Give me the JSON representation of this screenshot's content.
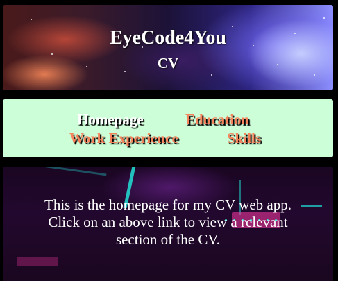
{
  "header": {
    "title": "EyeCode4You",
    "subtitle": "CV"
  },
  "nav": {
    "links": [
      {
        "label": "Homepage",
        "color": "#ffffff",
        "active": true
      },
      {
        "label": "Education",
        "color": "#f5845c",
        "active": false
      },
      {
        "label": "Work Experience",
        "color": "#f5845c",
        "active": false
      },
      {
        "label": "Skills",
        "color": "#f5845c",
        "active": false
      }
    ],
    "background": "#ccffd8"
  },
  "main": {
    "line1": "This is the homepage for my CV web app.",
    "line2": "Click on an above link to view a relevant section of the CV."
  }
}
